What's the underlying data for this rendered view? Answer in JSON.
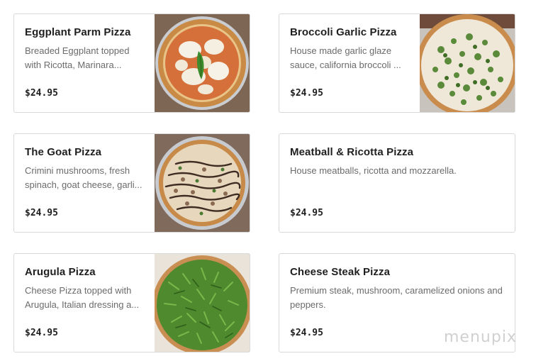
{
  "menu_items": [
    {
      "name": "Eggplant Parm Pizza",
      "description": "Breaded Eggplant topped with Ricotta, Marinara...",
      "price": "$24.95",
      "photo_icon": "eggplant-parm-pizza-photo"
    },
    {
      "name": "Broccoli Garlic Pizza",
      "description": "House made garlic glaze sauce, california broccoli ...",
      "price": "$24.95",
      "photo_icon": "broccoli-garlic-pizza-photo"
    },
    {
      "name": "The Goat Pizza",
      "description": "Crimini mushrooms, fresh spinach, goat cheese, garli...",
      "price": "$24.95",
      "photo_icon": "goat-pizza-photo"
    },
    {
      "name": "Meatball & Ricotta Pizza",
      "description": "House meatballs, ricotta and mozzarella.",
      "price": "$24.95"
    },
    {
      "name": "Arugula Pizza",
      "description": "Cheese Pizza topped with Arugula, Italian dressing a...",
      "price": "$24.95",
      "photo_icon": "arugula-pizza-photo"
    },
    {
      "name": "Cheese Steak Pizza",
      "description": "Premium steak, mushroom, caramelized onions and peppers.",
      "price": "$24.95"
    }
  ],
  "watermark": "menupix",
  "colors": {
    "card_border": "#d9d9d9",
    "title": "#1f1f1f",
    "description": "#6b6b6b",
    "price": "#1f1f1f"
  }
}
